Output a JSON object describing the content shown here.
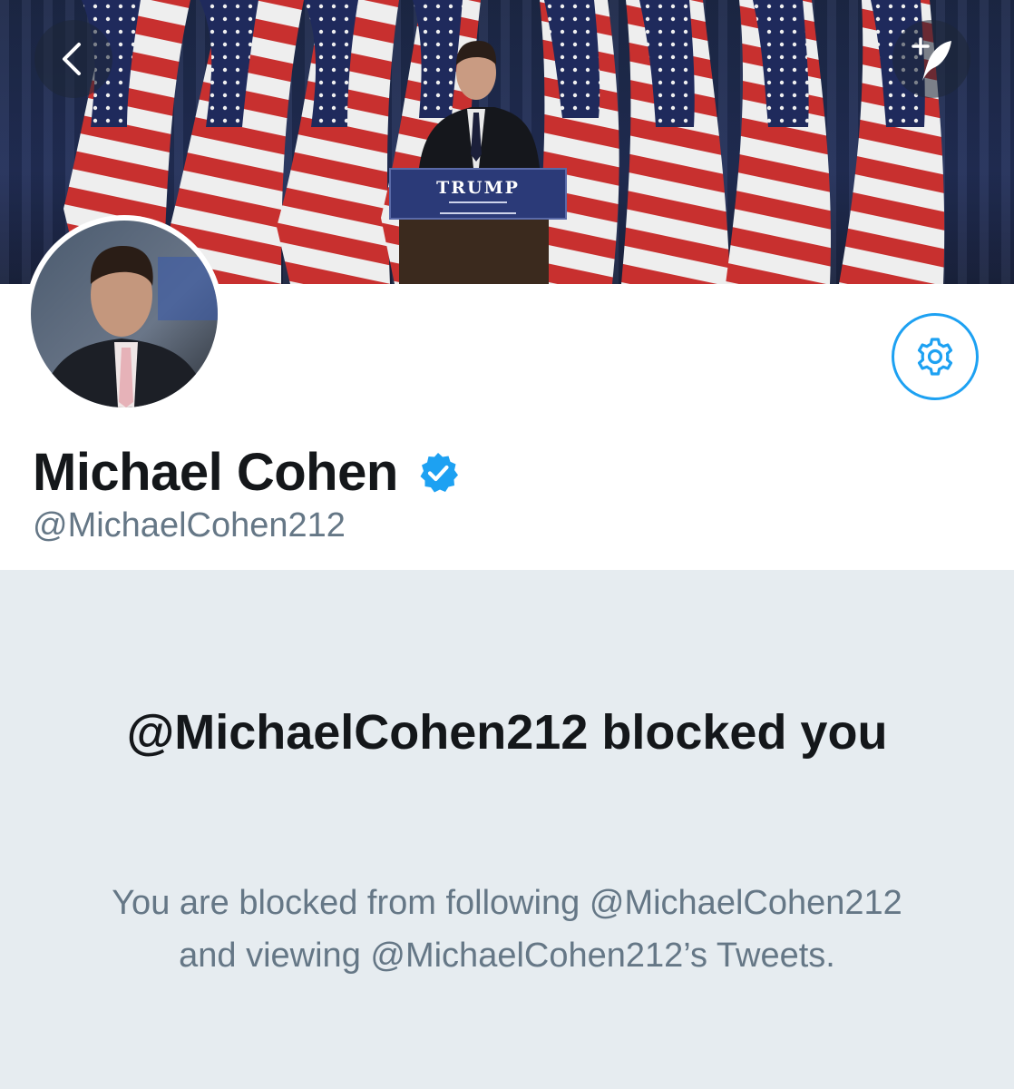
{
  "banner": {
    "podium_sign": "TRUMP",
    "back_button_label": "Back",
    "compose_button_label": "Compose Tweet"
  },
  "profile": {
    "display_name": "Michael Cohen",
    "handle": "@MichaelCohen212",
    "verified": true
  },
  "settings_button_label": "Profile settings",
  "blocked": {
    "title": "@MichaelCohen212 blocked you",
    "description": "You are blocked from following @MichaelCohen212 and viewing @MichaelCohen212’s Tweets."
  },
  "colors": {
    "accent": "#1da1f2",
    "name_text": "#14171a",
    "secondary_text": "#657786",
    "section_background": "#e6ecf0"
  },
  "icons": {
    "back": "chevron-left-icon",
    "compose": "compose-quill-icon",
    "settings": "gear-icon",
    "verified": "verified-badge-icon"
  }
}
